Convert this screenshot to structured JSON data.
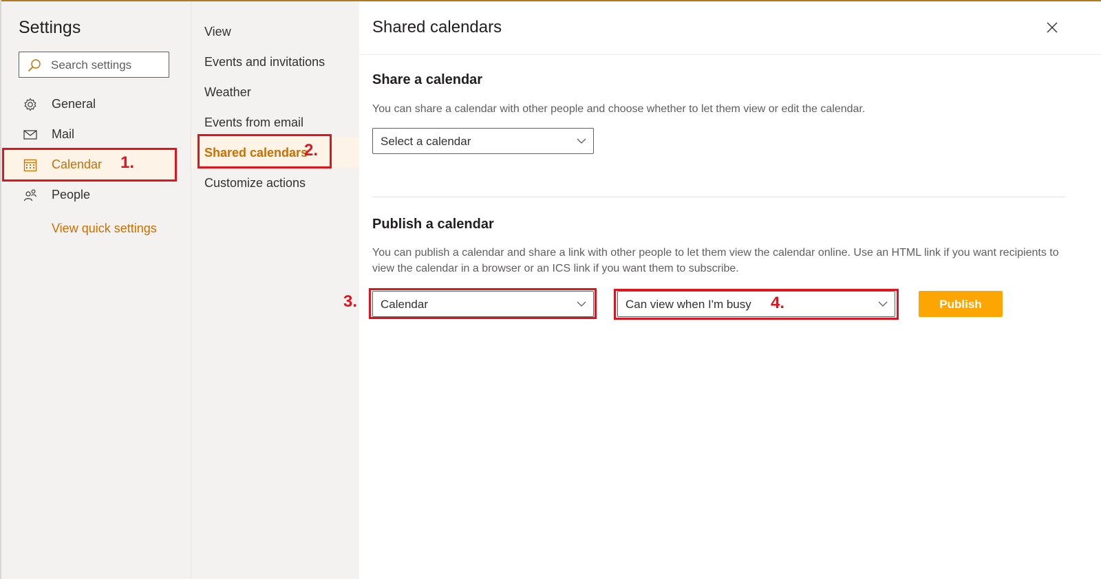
{
  "settings_title": "Settings",
  "search": {
    "placeholder": "Search settings"
  },
  "nav": {
    "items": [
      {
        "label": "General",
        "icon": "gear-icon"
      },
      {
        "label": "Mail",
        "icon": "mail-icon"
      },
      {
        "label": "Calendar",
        "icon": "calendar-icon",
        "selected": true
      },
      {
        "label": "People",
        "icon": "people-icon"
      }
    ],
    "quick_settings": "View quick settings"
  },
  "subnav": {
    "items": [
      {
        "label": "View"
      },
      {
        "label": "Events and invitations"
      },
      {
        "label": "Weather"
      },
      {
        "label": "Events from email"
      },
      {
        "label": "Shared calendars",
        "selected": true
      },
      {
        "label": "Customize actions"
      }
    ]
  },
  "content": {
    "title": "Shared calendars",
    "share": {
      "heading": "Share a calendar",
      "description": "You can share a calendar with other people and choose whether to let them view or edit the calendar.",
      "dropdown_value": "Select a calendar"
    },
    "publish": {
      "heading": "Publish a calendar",
      "description": "You can publish a calendar and share a link with other people to let them view the calendar online. Use an HTML link if you want recipients to view the calendar in a browser or an ICS link if you want them to subscribe.",
      "calendar_value": "Calendar",
      "permission_value": "Can view when I'm busy",
      "button_label": "Publish"
    }
  },
  "annotations": [
    "1.",
    "2.",
    "3.",
    "4."
  ],
  "colors": {
    "accent": "#c96f04",
    "publish_button": "#fca503",
    "highlight": "#e0141e",
    "pane_bg": "#f3f2f1"
  }
}
